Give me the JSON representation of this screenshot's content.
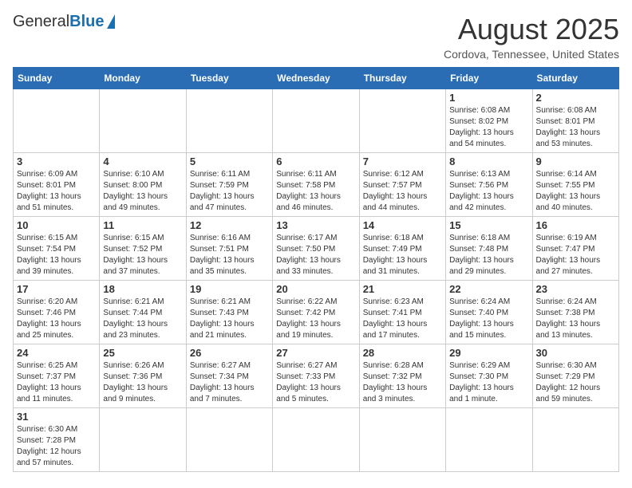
{
  "header": {
    "logo_general": "General",
    "logo_blue": "Blue",
    "month_title": "August 2025",
    "location": "Cordova, Tennessee, United States"
  },
  "days_of_week": [
    "Sunday",
    "Monday",
    "Tuesday",
    "Wednesday",
    "Thursday",
    "Friday",
    "Saturday"
  ],
  "weeks": [
    [
      {
        "day": "",
        "info": ""
      },
      {
        "day": "",
        "info": ""
      },
      {
        "day": "",
        "info": ""
      },
      {
        "day": "",
        "info": ""
      },
      {
        "day": "",
        "info": ""
      },
      {
        "day": "1",
        "info": "Sunrise: 6:08 AM\nSunset: 8:02 PM\nDaylight: 13 hours and 54 minutes."
      },
      {
        "day": "2",
        "info": "Sunrise: 6:08 AM\nSunset: 8:01 PM\nDaylight: 13 hours and 53 minutes."
      }
    ],
    [
      {
        "day": "3",
        "info": "Sunrise: 6:09 AM\nSunset: 8:01 PM\nDaylight: 13 hours and 51 minutes."
      },
      {
        "day": "4",
        "info": "Sunrise: 6:10 AM\nSunset: 8:00 PM\nDaylight: 13 hours and 49 minutes."
      },
      {
        "day": "5",
        "info": "Sunrise: 6:11 AM\nSunset: 7:59 PM\nDaylight: 13 hours and 47 minutes."
      },
      {
        "day": "6",
        "info": "Sunrise: 6:11 AM\nSunset: 7:58 PM\nDaylight: 13 hours and 46 minutes."
      },
      {
        "day": "7",
        "info": "Sunrise: 6:12 AM\nSunset: 7:57 PM\nDaylight: 13 hours and 44 minutes."
      },
      {
        "day": "8",
        "info": "Sunrise: 6:13 AM\nSunset: 7:56 PM\nDaylight: 13 hours and 42 minutes."
      },
      {
        "day": "9",
        "info": "Sunrise: 6:14 AM\nSunset: 7:55 PM\nDaylight: 13 hours and 40 minutes."
      }
    ],
    [
      {
        "day": "10",
        "info": "Sunrise: 6:15 AM\nSunset: 7:54 PM\nDaylight: 13 hours and 39 minutes."
      },
      {
        "day": "11",
        "info": "Sunrise: 6:15 AM\nSunset: 7:52 PM\nDaylight: 13 hours and 37 minutes."
      },
      {
        "day": "12",
        "info": "Sunrise: 6:16 AM\nSunset: 7:51 PM\nDaylight: 13 hours and 35 minutes."
      },
      {
        "day": "13",
        "info": "Sunrise: 6:17 AM\nSunset: 7:50 PM\nDaylight: 13 hours and 33 minutes."
      },
      {
        "day": "14",
        "info": "Sunrise: 6:18 AM\nSunset: 7:49 PM\nDaylight: 13 hours and 31 minutes."
      },
      {
        "day": "15",
        "info": "Sunrise: 6:18 AM\nSunset: 7:48 PM\nDaylight: 13 hours and 29 minutes."
      },
      {
        "day": "16",
        "info": "Sunrise: 6:19 AM\nSunset: 7:47 PM\nDaylight: 13 hours and 27 minutes."
      }
    ],
    [
      {
        "day": "17",
        "info": "Sunrise: 6:20 AM\nSunset: 7:46 PM\nDaylight: 13 hours and 25 minutes."
      },
      {
        "day": "18",
        "info": "Sunrise: 6:21 AM\nSunset: 7:44 PM\nDaylight: 13 hours and 23 minutes."
      },
      {
        "day": "19",
        "info": "Sunrise: 6:21 AM\nSunset: 7:43 PM\nDaylight: 13 hours and 21 minutes."
      },
      {
        "day": "20",
        "info": "Sunrise: 6:22 AM\nSunset: 7:42 PM\nDaylight: 13 hours and 19 minutes."
      },
      {
        "day": "21",
        "info": "Sunrise: 6:23 AM\nSunset: 7:41 PM\nDaylight: 13 hours and 17 minutes."
      },
      {
        "day": "22",
        "info": "Sunrise: 6:24 AM\nSunset: 7:40 PM\nDaylight: 13 hours and 15 minutes."
      },
      {
        "day": "23",
        "info": "Sunrise: 6:24 AM\nSunset: 7:38 PM\nDaylight: 13 hours and 13 minutes."
      }
    ],
    [
      {
        "day": "24",
        "info": "Sunrise: 6:25 AM\nSunset: 7:37 PM\nDaylight: 13 hours and 11 minutes."
      },
      {
        "day": "25",
        "info": "Sunrise: 6:26 AM\nSunset: 7:36 PM\nDaylight: 13 hours and 9 minutes."
      },
      {
        "day": "26",
        "info": "Sunrise: 6:27 AM\nSunset: 7:34 PM\nDaylight: 13 hours and 7 minutes."
      },
      {
        "day": "27",
        "info": "Sunrise: 6:27 AM\nSunset: 7:33 PM\nDaylight: 13 hours and 5 minutes."
      },
      {
        "day": "28",
        "info": "Sunrise: 6:28 AM\nSunset: 7:32 PM\nDaylight: 13 hours and 3 minutes."
      },
      {
        "day": "29",
        "info": "Sunrise: 6:29 AM\nSunset: 7:30 PM\nDaylight: 13 hours and 1 minute."
      },
      {
        "day": "30",
        "info": "Sunrise: 6:30 AM\nSunset: 7:29 PM\nDaylight: 12 hours and 59 minutes."
      }
    ],
    [
      {
        "day": "31",
        "info": "Sunrise: 6:30 AM\nSunset: 7:28 PM\nDaylight: 12 hours and 57 minutes."
      },
      {
        "day": "",
        "info": ""
      },
      {
        "day": "",
        "info": ""
      },
      {
        "day": "",
        "info": ""
      },
      {
        "day": "",
        "info": ""
      },
      {
        "day": "",
        "info": ""
      },
      {
        "day": "",
        "info": ""
      }
    ]
  ]
}
